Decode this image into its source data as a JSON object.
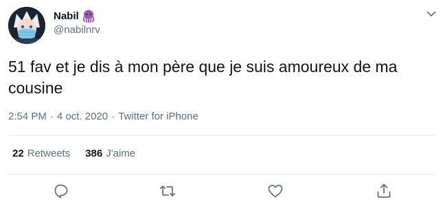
{
  "author": {
    "display_name": "Nabil",
    "name_emoji": "octopus-emoji",
    "handle": "@nabilnrv",
    "avatar": "anime-character-avatar"
  },
  "tweet": {
    "text": "51 fav et je dis à mon père que je suis amoureux de ma cousine",
    "time": "2:54 PM",
    "date": "4 oct. 2020",
    "separator": "·",
    "source": "Twitter for iPhone"
  },
  "stats": {
    "retweets_count": "22",
    "retweets_label": "Retweets",
    "likes_count": "386",
    "likes_label": "J'aime"
  },
  "actions": [
    "reply-icon",
    "retweet-icon",
    "like-icon",
    "share-icon"
  ],
  "colors": {
    "primary_text": "#0f1419",
    "secondary_text": "#5b7083",
    "divider": "#e6ecf0",
    "emoji": "#9b59b6"
  }
}
